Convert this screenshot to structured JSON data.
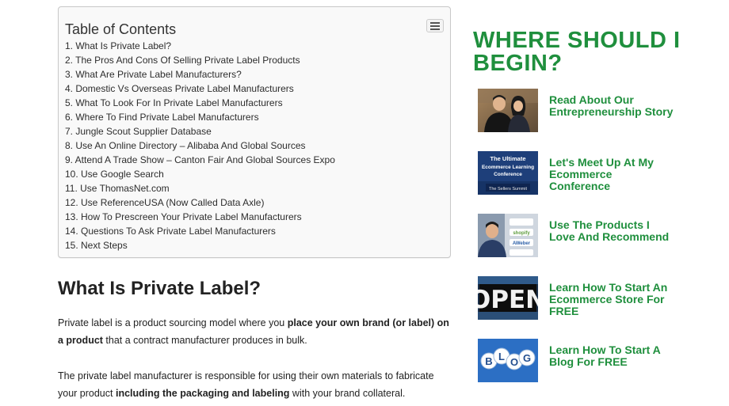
{
  "toc": {
    "title": "Table of Contents",
    "items": [
      "1. What Is Private Label?",
      "2. The Pros And Cons Of Selling Private Label Products",
      "3. What Are Private Label Manufacturers?",
      "4. Domestic Vs Overseas Private Label Manufacturers",
      "5. What To Look For In Private Label Manufacturers",
      "6. Where To Find Private Label Manufacturers",
      "7. Jungle Scout Supplier Database",
      "8. Use An Online Directory – Alibaba And Global Sources",
      "9. Attend A Trade Show – Canton Fair And Global Sources Expo",
      "10. Use Google Search",
      "11. Use ThomasNet.com",
      "12. Use ReferenceUSA (Now Called Data Axle)",
      "13. How To Prescreen Your Private Label Manufacturers",
      "14. Questions To Ask Private Label Manufacturers",
      "15. Next Steps"
    ]
  },
  "article": {
    "heading": "What Is Private Label?",
    "p1": {
      "a": "Private label is a product sourcing model where you ",
      "b": "place your own brand (or label) on a product",
      "c": " that a contract manufacturer produces in bulk."
    },
    "p2": {
      "a": "The private label manufacturer is responsible for using their own materials to fabricate your product ",
      "b": "including the packaging and labeling",
      "c": " with your brand collateral."
    }
  },
  "sidebar": {
    "title": "WHERE SHOULD I BEGIN?",
    "accent_color": "#1f8f3d",
    "items": [
      {
        "label": "Read About Our Entrepreneurship Story",
        "icon": "couple-photo"
      },
      {
        "label": "Let's Meet Up At My Ecommerce Conference",
        "icon": "conference-banner",
        "thumb_text": [
          "The Ultimate",
          "Ecommerce Learning",
          "Conference",
          "The Sellers Summit"
        ]
      },
      {
        "label": "Use The Products I Love And Recommend",
        "icon": "products-photo",
        "thumb_text": [
          "shopify",
          "AWeber"
        ]
      },
      {
        "label": "Learn How To Start An Ecommerce Store For FREE",
        "icon": "open-sign",
        "thumb_text": "OPEN"
      },
      {
        "label": "Learn How To Start A Blog For FREE",
        "icon": "blog-balls",
        "thumb_text": [
          "B",
          "L",
          "O",
          "G"
        ]
      }
    ]
  }
}
